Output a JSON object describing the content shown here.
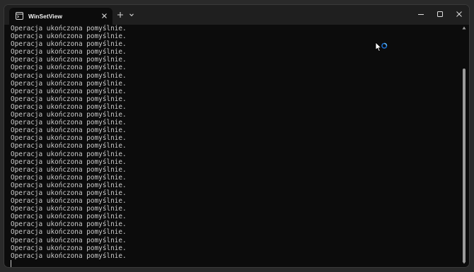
{
  "window": {
    "title": "WinSetView"
  },
  "tab": {
    "icon": "terminal-icon",
    "close_icon": "close-icon"
  },
  "titlebar": {
    "new_tab_icon": "plus-icon",
    "dropdown_icon": "chevron-down-icon",
    "minimize_icon": "minimize-icon",
    "maximize_icon": "maximize-icon",
    "close_icon": "close-icon"
  },
  "terminal": {
    "lines": [
      "Operacja ukończona pomyślnie.",
      "Operacja ukończona pomyślnie.",
      "Operacja ukończona pomyślnie.",
      "Operacja ukończona pomyślnie.",
      "Operacja ukończona pomyślnie.",
      "Operacja ukończona pomyślnie.",
      "Operacja ukończona pomyślnie.",
      "Operacja ukończona pomyślnie.",
      "Operacja ukończona pomyślnie.",
      "Operacja ukończona pomyślnie.",
      "Operacja ukończona pomyślnie.",
      "Operacja ukończona pomyślnie.",
      "Operacja ukończona pomyślnie.",
      "Operacja ukończona pomyślnie.",
      "Operacja ukończona pomyślnie.",
      "Operacja ukończona pomyślnie.",
      "Operacja ukończona pomyślnie.",
      "Operacja ukończona pomyślnie.",
      "Operacja ukończona pomyślnie.",
      "Operacja ukończona pomyślnie.",
      "Operacja ukończona pomyślnie.",
      "Operacja ukończona pomyślnie.",
      "Operacja ukończona pomyślnie.",
      "Operacja ukończona pomyślnie.",
      "Operacja ukończona pomyślnie.",
      "Operacja ukończona pomyślnie.",
      "Operacja ukończona pomyślnie.",
      "Operacja ukończona pomyślnie.",
      "Operacja ukończona pomyślnie.",
      "Operacja ukończona pomyślnie."
    ]
  },
  "colors": {
    "background": "#0c0c0c",
    "text": "#cccccc",
    "busy_indicator": "#1e90ff"
  },
  "pointer": {
    "icon": "busy-pointer-icon"
  }
}
